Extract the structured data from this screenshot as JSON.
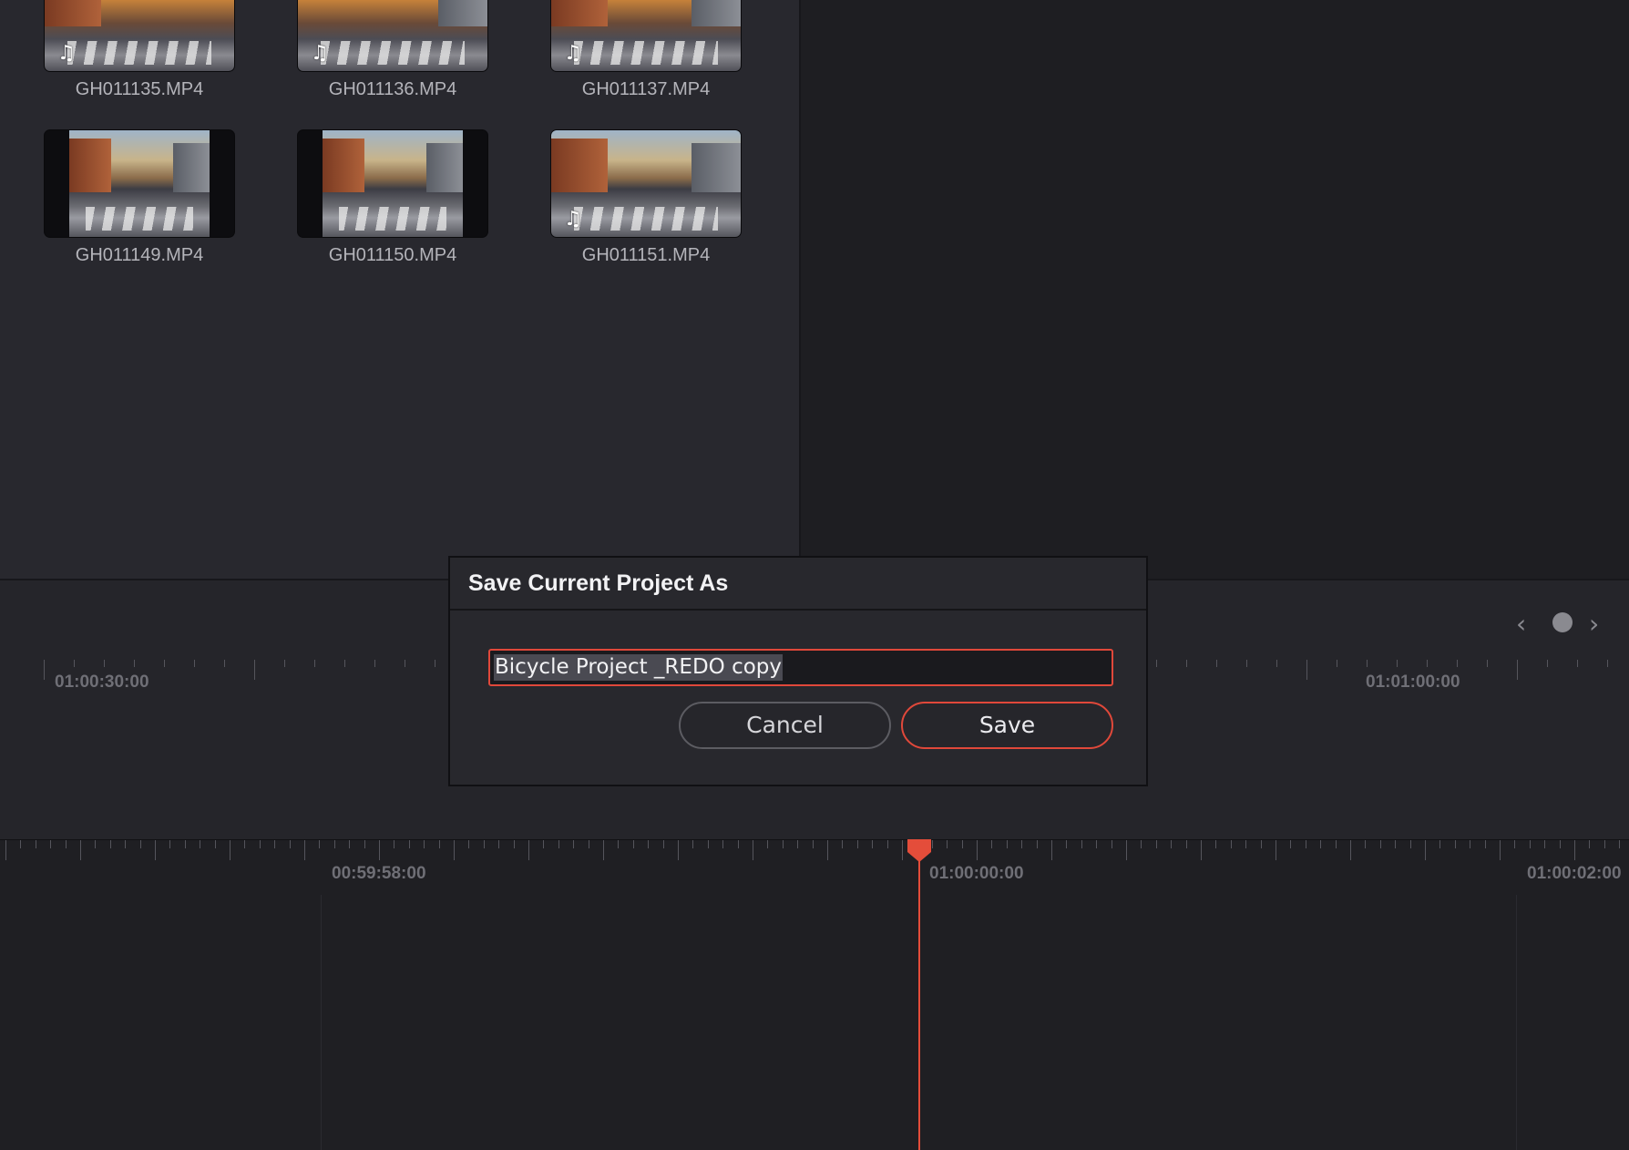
{
  "media_pool": {
    "clips": [
      {
        "name": "GH011135.MP4",
        "has_audio": true
      },
      {
        "name": "GH011136.MP4",
        "has_audio": true
      },
      {
        "name": "GH011137.MP4",
        "has_audio": true
      },
      {
        "name": "GH011149.MP4",
        "has_audio": false
      },
      {
        "name": "GH011150.MP4",
        "has_audio": false
      },
      {
        "name": "GH011151.MP4",
        "has_audio": true
      }
    ],
    "audio_icon": "music-note-icon"
  },
  "upper_timeline": {
    "timecodes": [
      "01:00:30:00",
      "01:01:00:00"
    ],
    "nav": {
      "prev": "‹",
      "next": "›"
    }
  },
  "lower_timeline": {
    "timecodes": [
      "00:59:58:00",
      "01:00:00:00",
      "01:00:02:00"
    ],
    "playhead_color": "#e44d3a"
  },
  "dialog": {
    "title": "Save Current Project As",
    "input_value": "Bicycle Project _REDO copy",
    "cancel_label": "Cancel",
    "save_label": "Save",
    "accent": "#e0483a"
  }
}
